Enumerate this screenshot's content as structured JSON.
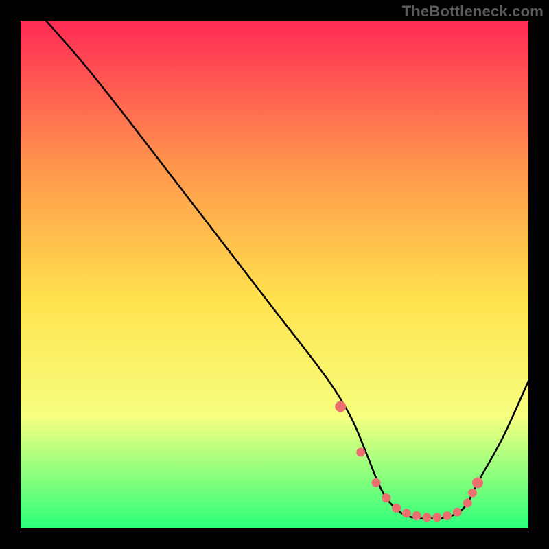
{
  "watermark": "TheBottleneck.com",
  "chart_data": {
    "type": "line",
    "title": "",
    "xlabel": "",
    "ylabel": "",
    "xlim": [
      0,
      100
    ],
    "ylim": [
      0,
      100
    ],
    "grid": false,
    "series": [
      {
        "name": "curve",
        "x": [
          5,
          12,
          20,
          30,
          40,
          50,
          60,
          65,
          68,
          70,
          72,
          75,
          78,
          80,
          83,
          86,
          88,
          90,
          95,
          100
        ],
        "y": [
          100,
          92,
          82,
          69,
          56,
          43,
          30,
          22,
          15,
          10,
          6,
          3,
          2,
          2,
          2,
          3,
          5,
          9,
          18,
          29
        ],
        "color": "#000000"
      }
    ],
    "highlight_points": {
      "name": "dots",
      "color": "#eb6f6f",
      "x": [
        63,
        67,
        70,
        72,
        74,
        76,
        78,
        80,
        82,
        84,
        86,
        88,
        89,
        90
      ],
      "y": [
        24,
        15,
        9,
        6,
        4,
        3,
        2.5,
        2.2,
        2.2,
        2.5,
        3.2,
        5,
        7,
        9
      ]
    },
    "background_gradient": {
      "top": "#ff2a55",
      "mid_upper": "#ff944d",
      "mid": "#ffe24d",
      "mid_lower": "#f6ff80",
      "bottom": "#2bff7a"
    }
  }
}
